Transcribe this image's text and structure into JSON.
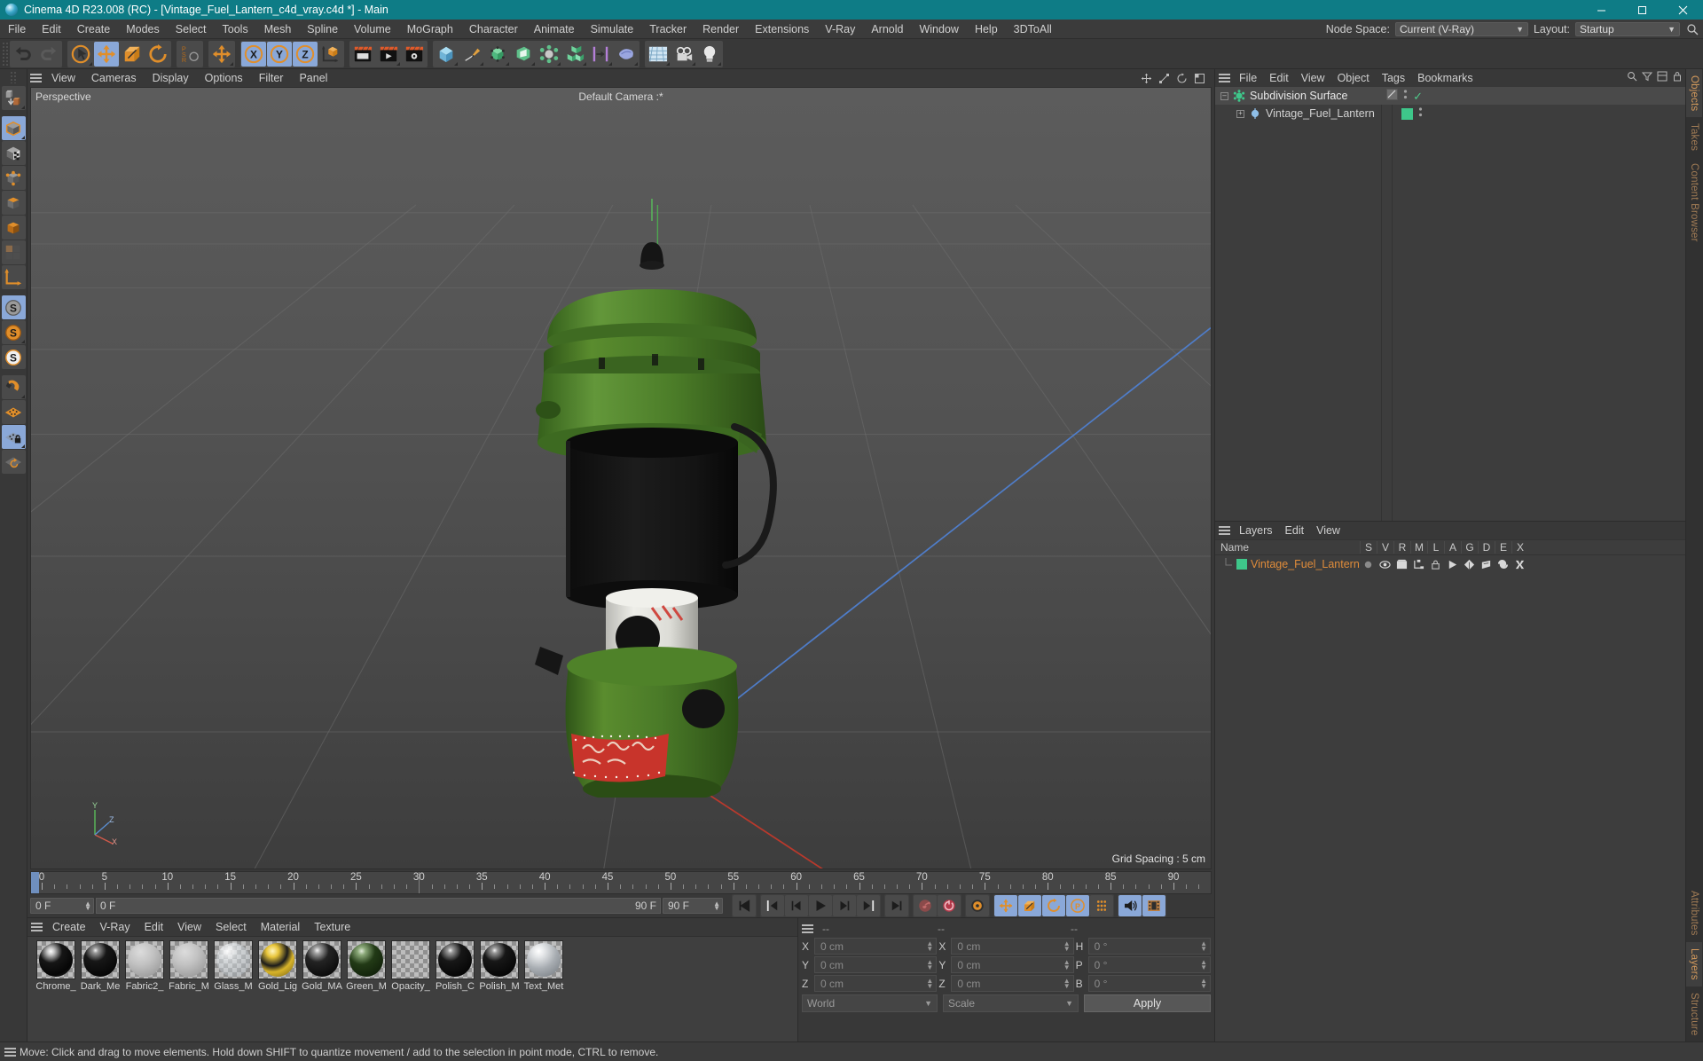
{
  "titlebar": {
    "text": "Cinema 4D R23.008 (RC) - [Vintage_Fuel_Lantern_c4d_vray.c4d *] - Main",
    "logo_icon": "c4d-logo-icon",
    "minimize_icon": "minimize-icon",
    "maximize_icon": "maximize-icon",
    "close_icon": "close-icon",
    "bg_color": "#0e7c86"
  },
  "menubar": {
    "items": [
      "File",
      "Edit",
      "Create",
      "Modes",
      "Select",
      "Tools",
      "Mesh",
      "Spline",
      "Volume",
      "MoGraph",
      "Character",
      "Animate",
      "Simulate",
      "Tracker",
      "Render",
      "Extensions",
      "V-Ray",
      "Arnold",
      "Window",
      "Help",
      "3DToAll"
    ],
    "node_space_label": "Node Space:",
    "node_space_value": "Current (V-Ray)",
    "layout_label": "Layout:",
    "layout_value": "Startup",
    "search_icon": "search-icon"
  },
  "toolbar": {
    "groups": [
      {
        "name": "undo-redo",
        "buttons": [
          {
            "name": "undo-button",
            "icon": "undo-arrow-icon",
            "active": false,
            "corner": false
          },
          {
            "name": "redo-button",
            "icon": "redo-arrow-icon",
            "active": false,
            "corner": false
          }
        ]
      },
      {
        "name": "transform-tools",
        "buttons": [
          {
            "name": "select-tool",
            "icon": "cursor-circle-icon",
            "active": false,
            "corner": true
          },
          {
            "name": "move-tool",
            "icon": "move-arrows-icon",
            "active": true,
            "corner": false
          },
          {
            "name": "scale-tool",
            "icon": "scale-box-icon",
            "active": false,
            "corner": false
          },
          {
            "name": "rotate-tool",
            "icon": "rotate-circle-icon",
            "active": false,
            "corner": false
          }
        ]
      },
      {
        "name": "psr-lock",
        "buttons": [
          {
            "name": "psr-lock-button",
            "icon": "psr-icon",
            "active": false,
            "corner": false
          }
        ]
      },
      {
        "name": "move-mode",
        "buttons": [
          {
            "name": "move-mode-button",
            "icon": "move-arrows-icon",
            "active": false,
            "corner": true
          }
        ]
      },
      {
        "name": "axis-locks",
        "buttons": [
          {
            "name": "lock-x-axis",
            "icon": "x-axis-icon",
            "active": true,
            "corner": false
          },
          {
            "name": "lock-y-axis",
            "icon": "y-axis-icon",
            "active": true,
            "corner": false
          },
          {
            "name": "lock-z-axis",
            "icon": "z-axis-icon",
            "active": true,
            "corner": false
          },
          {
            "name": "world-object-coordinates",
            "icon": "world-axis-cube-icon",
            "active": false,
            "corner": false
          }
        ]
      },
      {
        "name": "render-tools",
        "buttons": [
          {
            "name": "render-view-button",
            "icon": "render-view-icon",
            "active": false,
            "corner": false
          },
          {
            "name": "render-to-picture-viewer-button",
            "icon": "render-picture-icon",
            "active": false,
            "corner": true
          },
          {
            "name": "render-settings-button",
            "icon": "render-settings-icon",
            "active": false,
            "corner": false
          }
        ]
      },
      {
        "name": "create-objects",
        "buttons": [
          {
            "name": "add-primitive-cube-button",
            "icon": "cube-icon",
            "active": false,
            "corner": true
          },
          {
            "name": "add-spline-pen-button",
            "icon": "pen-spline-icon",
            "active": false,
            "corner": true
          },
          {
            "name": "add-generator-button",
            "icon": "nurbs-generator-icon",
            "active": false,
            "corner": true
          },
          {
            "name": "add-bend-deformer-button",
            "icon": "deformer-icon",
            "active": false,
            "corner": true
          },
          {
            "name": "add-scene-helper-button",
            "icon": "scene-atom-icon",
            "active": false,
            "corner": true
          },
          {
            "name": "add-mograph-cloner-button",
            "icon": "mograph-cubes-icon",
            "active": false,
            "corner": true
          },
          {
            "name": "add-field-button",
            "icon": "field-icon",
            "active": false,
            "corner": true
          },
          {
            "name": "add-simulation-button",
            "icon": "cloth-icon",
            "active": false,
            "corner": true
          }
        ]
      },
      {
        "name": "scene-elements",
        "buttons": [
          {
            "name": "add-floor-button",
            "icon": "floor-grid-icon",
            "active": false,
            "corner": true
          },
          {
            "name": "add-camera-button",
            "icon": "camera-icon",
            "active": false,
            "corner": true
          },
          {
            "name": "add-light-button",
            "icon": "light-bulb-icon",
            "active": false,
            "corner": true
          }
        ]
      }
    ]
  },
  "leftbar": {
    "buttons": [
      {
        "name": "make-editable-button",
        "icon": "make-editable-icon",
        "active": false,
        "corner": true
      },
      {
        "name": "model-mode-button",
        "icon": "model-cube-icon",
        "active": true,
        "corner": true
      },
      {
        "name": "texture-mode-button",
        "icon": "texture-cube-icon",
        "active": false,
        "corner": false
      },
      {
        "name": "point-mode-button",
        "icon": "points-cube-icon",
        "active": false,
        "corner": false
      },
      {
        "name": "edge-mode-button",
        "icon": "edge-cube-icon",
        "active": false,
        "corner": false
      },
      {
        "name": "polygon-mode-button",
        "icon": "polygon-cube-icon",
        "active": false,
        "corner": false
      },
      {
        "name": "uv-mode-button",
        "icon": "uv-tiles-icon",
        "active": false,
        "corner": false
      },
      {
        "name": "axis-mode-button",
        "icon": "axis-modify-icon",
        "active": false,
        "corner": false
      },
      {
        "name": "viewport-solo-off-button",
        "icon": "solo-off-icon",
        "active": true,
        "corner": false
      },
      {
        "name": "viewport-solo-single-button",
        "icon": "solo-single-icon",
        "active": false,
        "corner": true
      },
      {
        "name": "viewport-solo-hierarchy-button",
        "icon": "solo-hierarchy-icon",
        "active": false,
        "corner": false
      },
      {
        "name": "snap-magnet-button",
        "icon": "magnet-snap-icon",
        "active": false,
        "corner": true
      },
      {
        "name": "workplane-button",
        "icon": "workplane-icon",
        "active": false,
        "corner": false
      },
      {
        "name": "workplane-lock-button",
        "icon": "workplane-lock-icon",
        "active": true,
        "corner": true
      },
      {
        "name": "workplane-align-button",
        "icon": "workplane-rotate-icon",
        "active": false,
        "corner": false
      }
    ]
  },
  "viewport": {
    "menu": [
      "View",
      "Cameras",
      "Display",
      "Options",
      "Filter",
      "Panel"
    ],
    "hamburger_icon": "hamburger-icon",
    "projection_label": "Perspective",
    "camera_label": "Default Camera :*",
    "grid_spacing": "Grid Spacing : 5 cm",
    "axis_gizmo": {
      "y": "Y",
      "z": "Z",
      "x": "X"
    },
    "corner_icons": [
      "viewport-move-icon",
      "viewport-scale-icon",
      "viewport-rotate-icon",
      "viewport-maximize-icon"
    ],
    "model_name": "Vintage Fuel Lantern",
    "model_colors": {
      "body_green": "#4a7a28",
      "body_green_dark": "#3a6020",
      "glass_black": "#161616",
      "tank_white": "#e8e8e4",
      "label_red": "#c8342b",
      "cap_black": "#1a1a1a"
    }
  },
  "timeline": {
    "ticks": [
      0,
      5,
      10,
      15,
      20,
      25,
      30,
      35,
      40,
      45,
      50,
      55,
      60,
      65,
      70,
      75,
      80,
      85,
      90
    ],
    "current_frame_field": "0 F",
    "start_frame": "0 F",
    "end_frame": "90 F",
    "preview_end": "90 F",
    "right_frame_field": "0 F",
    "controls": [
      {
        "name": "go-to-start-button",
        "icon": "skip-start-icon"
      },
      {
        "name": "go-to-previous-key-button",
        "icon": "prev-key-icon"
      },
      {
        "name": "go-to-previous-frame-button",
        "icon": "step-back-icon"
      },
      {
        "name": "play-button",
        "icon": "play-icon"
      },
      {
        "name": "go-to-next-frame-button",
        "icon": "step-forward-icon"
      },
      {
        "name": "go-to-next-key-button",
        "icon": "next-key-icon"
      },
      {
        "name": "go-to-end-button",
        "icon": "skip-end-icon"
      },
      {
        "name": "record-active-objects-button",
        "icon": "record-key-icon"
      },
      {
        "name": "autokeying-button",
        "icon": "autokey-icon"
      },
      {
        "name": "keyframe-settings-button",
        "icon": "key-settings-icon"
      },
      {
        "name": "position-key-toggle",
        "icon": "position-key-icon",
        "active": true
      },
      {
        "name": "scale-key-toggle",
        "icon": "scale-key-icon",
        "active": true
      },
      {
        "name": "rotation-key-toggle",
        "icon": "rotation-key-icon",
        "active": true
      },
      {
        "name": "parameter-key-toggle",
        "icon": "parameter-key-icon",
        "active": true
      },
      {
        "name": "point-level-animation-toggle",
        "icon": "pla-dots-icon",
        "active": false
      },
      {
        "name": "sound-toggle",
        "icon": "sound-icon",
        "active": true
      },
      {
        "name": "film-strip-button",
        "icon": "film-strip-icon",
        "active": true
      }
    ]
  },
  "material_manager": {
    "menu": [
      "Create",
      "V-Ray",
      "Edit",
      "View",
      "Select",
      "Material",
      "Texture"
    ],
    "hamburger_icon": "hamburger-icon",
    "materials": [
      {
        "name": "Chrome_",
        "ball": "chrome",
        "color": "#0d0d0d"
      },
      {
        "name": "Dark_Me",
        "ball": "dark",
        "color": "#101010"
      },
      {
        "name": "Fabric2_",
        "ball": "fabric",
        "color": "#b9b9b9"
      },
      {
        "name": "Fabric_M",
        "ball": "fabric",
        "color": "#bdbdbd"
      },
      {
        "name": "Glass_M",
        "ball": "glass",
        "color": "#d8dde0"
      },
      {
        "name": "Gold_Lig",
        "ball": "gold",
        "color": "#c9a228"
      },
      {
        "name": "Gold_MA",
        "ball": "darkgold",
        "color": "#2e2e2e"
      },
      {
        "name": "Green_M",
        "ball": "green",
        "color": "#26441c"
      },
      {
        "name": "Opacity_",
        "ball": "opacity",
        "color": "transparent"
      },
      {
        "name": "Polish_C",
        "ball": "dark",
        "color": "#121212"
      },
      {
        "name": "Polish_M",
        "ball": "dark",
        "color": "#151515"
      },
      {
        "name": "Text_Met",
        "ball": "silver",
        "color": "#b0b4b8"
      }
    ]
  },
  "coordinates": {
    "hamburger_icon": "hamburger-icon",
    "headers": [
      "--",
      "--",
      "--"
    ],
    "rows": [
      {
        "a1": "X",
        "v1": "0 cm",
        "a2": "X",
        "v2": "0 cm",
        "a3": "H",
        "v3": "0 °"
      },
      {
        "a1": "Y",
        "v1": "0 cm",
        "a2": "Y",
        "v2": "0 cm",
        "a3": "P",
        "v3": "0 °"
      },
      {
        "a1": "Z",
        "v1": "0 cm",
        "a2": "Z",
        "v2": "0 cm",
        "a3": "B",
        "v3": "0 °"
      }
    ],
    "coord_system": "World",
    "transform_mode": "Scale",
    "apply_label": "Apply"
  },
  "object_manager": {
    "menu": [
      "File",
      "Edit",
      "View",
      "Object",
      "Tags",
      "Bookmarks"
    ],
    "hamburger_icon": "hamburger-icon",
    "search_icon": "search-icon",
    "filter_icon": "filter-icon",
    "layout_icon": "layout-icon",
    "lock_icon": "lock-icon",
    "items": [
      {
        "name": "Subdivision Surface",
        "icon": "subdivision-surface-icon",
        "indent": 0,
        "selected": true,
        "tag_type": "render-tag",
        "check": "✓",
        "expanded": true
      },
      {
        "name": "Vintage_Fuel_Lantern",
        "icon": "null-object-icon",
        "indent": 1,
        "selected": false,
        "tag_type": "layer-swatch",
        "swatch_color": "#3ec78a",
        "expanded": false
      }
    ]
  },
  "layers_manager": {
    "menu": [
      "Layers",
      "Edit",
      "View"
    ],
    "hamburger_icon": "hamburger-icon",
    "columns": [
      "S",
      "V",
      "R",
      "M",
      "L",
      "A",
      "G",
      "D",
      "E",
      "X"
    ],
    "name_header": "Name",
    "rows": [
      {
        "name": "Vintage_Fuel_Lantern",
        "color": "#3ec78a",
        "text_color": "#e08c3a",
        "cells": [
          "solo-dot-icon",
          "eye-icon",
          "render-icon",
          "manager-icon",
          "lock-icon",
          "animation-icon",
          "generator-icon",
          "deformer-icon",
          "expression-icon",
          "xpresso-icon"
        ]
      }
    ]
  },
  "right_tabs": {
    "top": [
      {
        "label": "Objects",
        "active": true
      },
      {
        "label": "Takes",
        "active": false
      },
      {
        "label": "Content Browser",
        "active": false
      }
    ],
    "bottom": [
      {
        "label": "Attributes",
        "active": false
      },
      {
        "label": "Layers",
        "active": true
      },
      {
        "label": "Structure",
        "active": false
      }
    ]
  },
  "status_bar": {
    "hamburger_icon": "hamburger-icon",
    "message": "Move: Click and drag to move elements. Hold down SHIFT to quantize movement / add to the selection in point mode, CTRL to remove."
  }
}
